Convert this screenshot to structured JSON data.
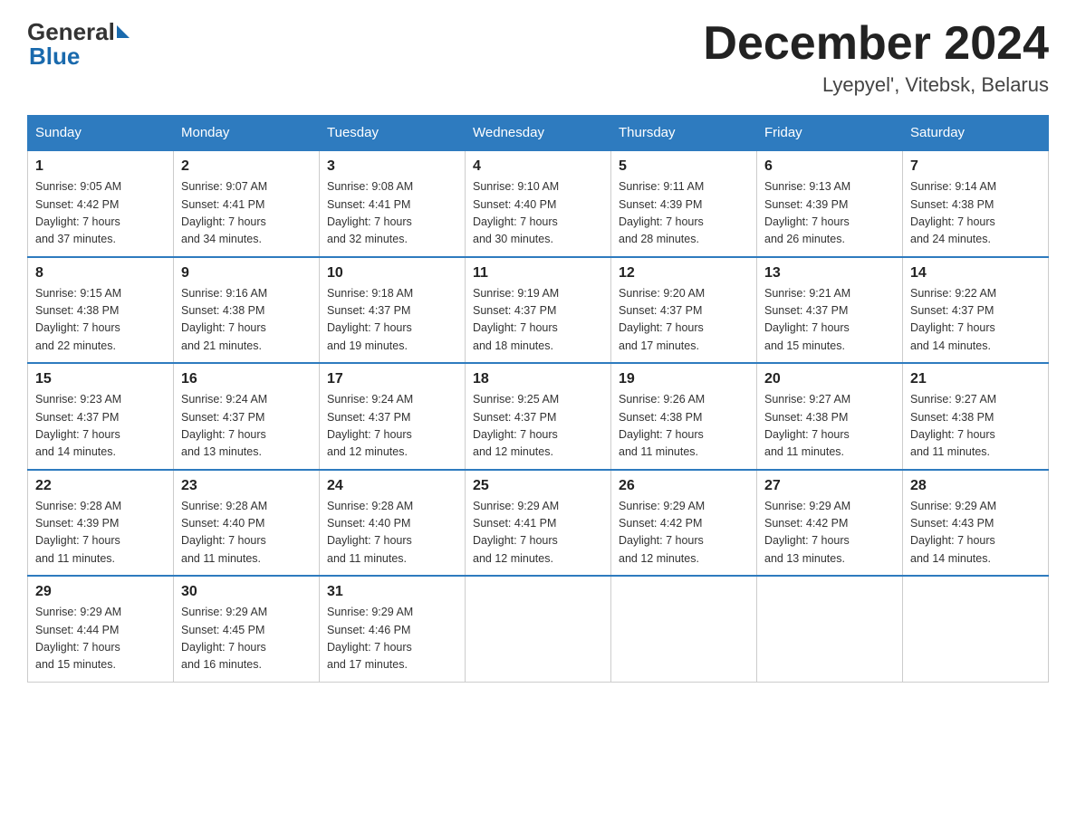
{
  "logo": {
    "general": "General",
    "blue": "Blue"
  },
  "title": "December 2024",
  "location": "Lyepyel', Vitebsk, Belarus",
  "days_of_week": [
    "Sunday",
    "Monday",
    "Tuesday",
    "Wednesday",
    "Thursday",
    "Friday",
    "Saturday"
  ],
  "weeks": [
    [
      {
        "day": "1",
        "info": "Sunrise: 9:05 AM\nSunset: 4:42 PM\nDaylight: 7 hours\nand 37 minutes."
      },
      {
        "day": "2",
        "info": "Sunrise: 9:07 AM\nSunset: 4:41 PM\nDaylight: 7 hours\nand 34 minutes."
      },
      {
        "day": "3",
        "info": "Sunrise: 9:08 AM\nSunset: 4:41 PM\nDaylight: 7 hours\nand 32 minutes."
      },
      {
        "day": "4",
        "info": "Sunrise: 9:10 AM\nSunset: 4:40 PM\nDaylight: 7 hours\nand 30 minutes."
      },
      {
        "day": "5",
        "info": "Sunrise: 9:11 AM\nSunset: 4:39 PM\nDaylight: 7 hours\nand 28 minutes."
      },
      {
        "day": "6",
        "info": "Sunrise: 9:13 AM\nSunset: 4:39 PM\nDaylight: 7 hours\nand 26 minutes."
      },
      {
        "day": "7",
        "info": "Sunrise: 9:14 AM\nSunset: 4:38 PM\nDaylight: 7 hours\nand 24 minutes."
      }
    ],
    [
      {
        "day": "8",
        "info": "Sunrise: 9:15 AM\nSunset: 4:38 PM\nDaylight: 7 hours\nand 22 minutes."
      },
      {
        "day": "9",
        "info": "Sunrise: 9:16 AM\nSunset: 4:38 PM\nDaylight: 7 hours\nand 21 minutes."
      },
      {
        "day": "10",
        "info": "Sunrise: 9:18 AM\nSunset: 4:37 PM\nDaylight: 7 hours\nand 19 minutes."
      },
      {
        "day": "11",
        "info": "Sunrise: 9:19 AM\nSunset: 4:37 PM\nDaylight: 7 hours\nand 18 minutes."
      },
      {
        "day": "12",
        "info": "Sunrise: 9:20 AM\nSunset: 4:37 PM\nDaylight: 7 hours\nand 17 minutes."
      },
      {
        "day": "13",
        "info": "Sunrise: 9:21 AM\nSunset: 4:37 PM\nDaylight: 7 hours\nand 15 minutes."
      },
      {
        "day": "14",
        "info": "Sunrise: 9:22 AM\nSunset: 4:37 PM\nDaylight: 7 hours\nand 14 minutes."
      }
    ],
    [
      {
        "day": "15",
        "info": "Sunrise: 9:23 AM\nSunset: 4:37 PM\nDaylight: 7 hours\nand 14 minutes."
      },
      {
        "day": "16",
        "info": "Sunrise: 9:24 AM\nSunset: 4:37 PM\nDaylight: 7 hours\nand 13 minutes."
      },
      {
        "day": "17",
        "info": "Sunrise: 9:24 AM\nSunset: 4:37 PM\nDaylight: 7 hours\nand 12 minutes."
      },
      {
        "day": "18",
        "info": "Sunrise: 9:25 AM\nSunset: 4:37 PM\nDaylight: 7 hours\nand 12 minutes."
      },
      {
        "day": "19",
        "info": "Sunrise: 9:26 AM\nSunset: 4:38 PM\nDaylight: 7 hours\nand 11 minutes."
      },
      {
        "day": "20",
        "info": "Sunrise: 9:27 AM\nSunset: 4:38 PM\nDaylight: 7 hours\nand 11 minutes."
      },
      {
        "day": "21",
        "info": "Sunrise: 9:27 AM\nSunset: 4:38 PM\nDaylight: 7 hours\nand 11 minutes."
      }
    ],
    [
      {
        "day": "22",
        "info": "Sunrise: 9:28 AM\nSunset: 4:39 PM\nDaylight: 7 hours\nand 11 minutes."
      },
      {
        "day": "23",
        "info": "Sunrise: 9:28 AM\nSunset: 4:40 PM\nDaylight: 7 hours\nand 11 minutes."
      },
      {
        "day": "24",
        "info": "Sunrise: 9:28 AM\nSunset: 4:40 PM\nDaylight: 7 hours\nand 11 minutes."
      },
      {
        "day": "25",
        "info": "Sunrise: 9:29 AM\nSunset: 4:41 PM\nDaylight: 7 hours\nand 12 minutes."
      },
      {
        "day": "26",
        "info": "Sunrise: 9:29 AM\nSunset: 4:42 PM\nDaylight: 7 hours\nand 12 minutes."
      },
      {
        "day": "27",
        "info": "Sunrise: 9:29 AM\nSunset: 4:42 PM\nDaylight: 7 hours\nand 13 minutes."
      },
      {
        "day": "28",
        "info": "Sunrise: 9:29 AM\nSunset: 4:43 PM\nDaylight: 7 hours\nand 14 minutes."
      }
    ],
    [
      {
        "day": "29",
        "info": "Sunrise: 9:29 AM\nSunset: 4:44 PM\nDaylight: 7 hours\nand 15 minutes."
      },
      {
        "day": "30",
        "info": "Sunrise: 9:29 AM\nSunset: 4:45 PM\nDaylight: 7 hours\nand 16 minutes."
      },
      {
        "day": "31",
        "info": "Sunrise: 9:29 AM\nSunset: 4:46 PM\nDaylight: 7 hours\nand 17 minutes."
      },
      null,
      null,
      null,
      null
    ]
  ]
}
